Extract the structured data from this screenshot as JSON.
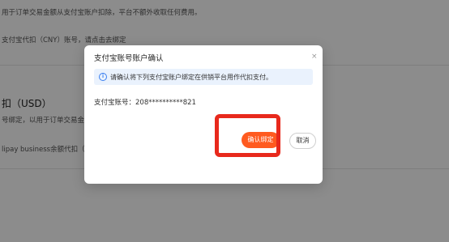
{
  "background": {
    "line1": "用于订单交易金额从支付宝账户扣除，平台不额外收取任何费用。",
    "line2": "支付宝代扣（CNY）账号，请点击去绑定",
    "heading": "扣（USD）",
    "line3": "号绑定，以用于订单交易金额",
    "line4": "lipay business余额代扣（US"
  },
  "modal": {
    "title": "支付宝账号账户确认",
    "close_icon": "×",
    "info_icon": "i",
    "info_text": "请确认将下列支付宝账户绑定在供销平台用作代扣支付。",
    "account_label": "支付宝账号：",
    "account_value": "208**********821",
    "confirm_label": "确认绑定",
    "cancel_label": "取消"
  },
  "colors": {
    "accent": "#ff5a1f",
    "info_bg": "#eaf2fd",
    "info_icon": "#3a7ff0",
    "highlight_border": "#e8291c"
  }
}
